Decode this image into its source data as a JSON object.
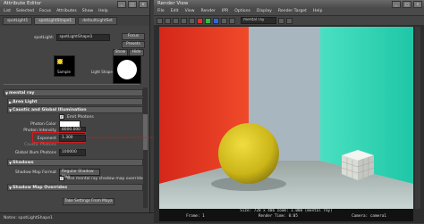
{
  "attr_editor": {
    "title": "Attribute Editor",
    "menu": [
      "List",
      "Selected",
      "Focus",
      "Attributes",
      "Show",
      "Help"
    ],
    "tabs": [
      "spotLight1",
      "spotLightShape1",
      "defaultLightSet"
    ],
    "node_label": "spotLight:",
    "node_value": "spotLightShape1",
    "focus_btn": "Focus",
    "presets_btn": "Presets",
    "show_btn": "Show",
    "hide_btn": "Hide",
    "sample_label": "Sample",
    "light_shape_label": "Light Shape",
    "mental_ray_header": "mental ray",
    "area_light_header": "Area Light",
    "caustic_header": "Caustic and Global Illumination",
    "emit_photons_label": "Emit Photons",
    "photon_color_label": "Photon Color",
    "photon_intensity_label": "Photon Intensity",
    "photon_intensity_value": "8000.000",
    "exponent_label": "Exponent",
    "exponent_value": "1.300",
    "caustic_photons_label": "Caustic Photons",
    "global_illum_photons_label": "Global Illum Photons",
    "global_illum_photons_value": "100000",
    "shadows_header": "Shadows",
    "shadow_map_format_label": "Shadow Map Format",
    "shadow_map_format_value": "Regular Shadow Map",
    "use_shadow_overrides_label": "Use mental ray shadow map overrides",
    "shadow_map_overrides_header": "Shadow Map Overrides",
    "take_settings_btn": "Take Settings From Maya",
    "notes_label": "Notes: spotLightShape1"
  },
  "render_view": {
    "title": "Render View",
    "menu": [
      "File",
      "Edit",
      "View",
      "Render",
      "IPR",
      "Options",
      "Display",
      "Render Target",
      "Help"
    ],
    "layer_value": "mental ray",
    "footer_line1": "Size: 720 x 486 zoom: 1.000     (mental ray)",
    "footer_frame": "Frame: 1",
    "footer_render_time": "Render Time: 0:05",
    "footer_camera": "Camera: camera1"
  },
  "colors": {
    "annotation_red": "#d7191c",
    "wall_red": "#e0321f",
    "wall_teal": "#2ad2b0",
    "sphere_yellow": "#d9c51e"
  }
}
